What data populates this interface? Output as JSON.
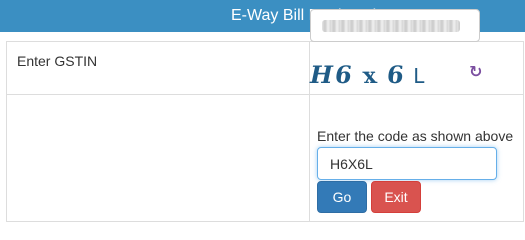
{
  "header": {
    "title": "E-Way Bill Registration Form"
  },
  "form": {
    "gstin_label": "Enter GSTIN",
    "captcha": {
      "image_text": [
        "H",
        "6",
        "x",
        "6",
        "L"
      ],
      "instruction": "Enter the code as shown above",
      "input_value": "H6X6L"
    },
    "buttons": {
      "go": "Go",
      "exit": "Exit"
    }
  },
  "icons": {
    "refresh": "refresh-icon"
  },
  "colors": {
    "header_bg": "#3b8fc2",
    "go_button": "#337ab7",
    "exit_button": "#d9534f",
    "captcha_text": "#1f5b86",
    "refresh_icon": "#7b4fa0"
  }
}
